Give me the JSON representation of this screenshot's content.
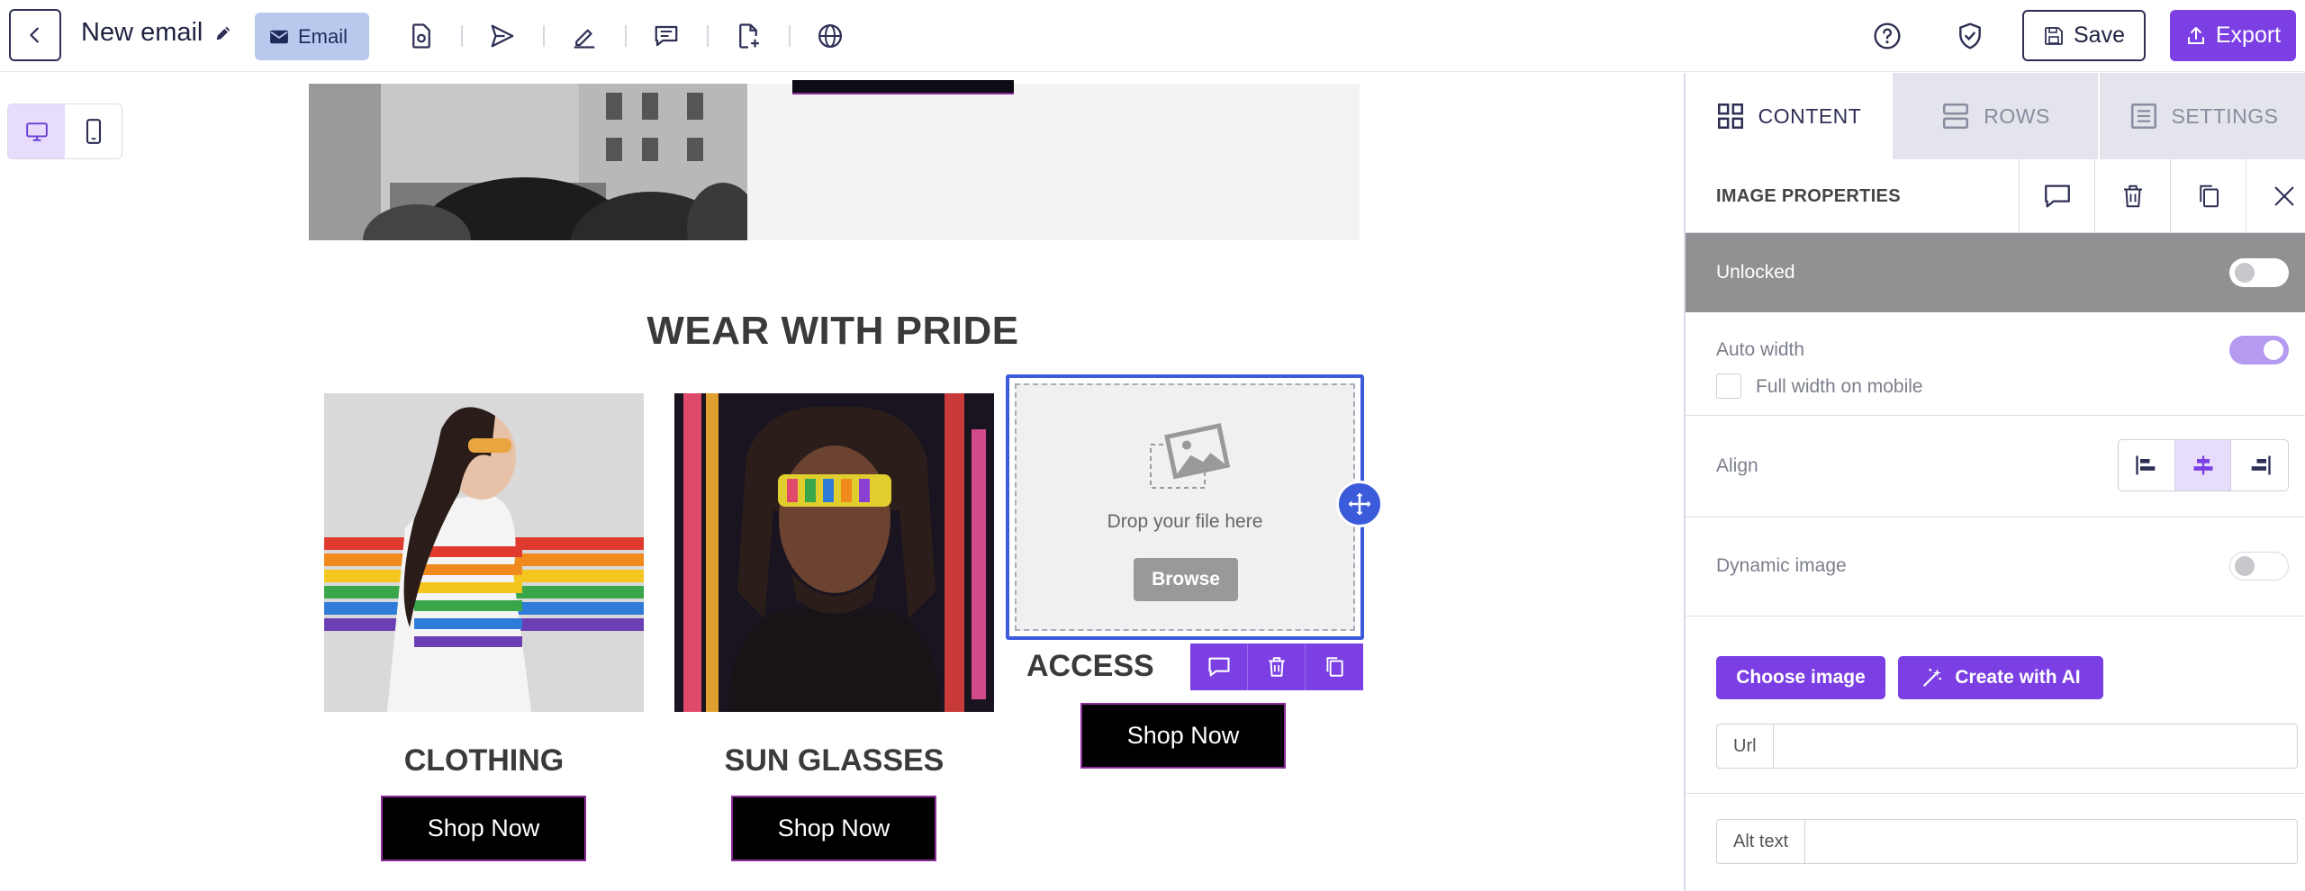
{
  "app": {
    "doc_title": "New email",
    "email_pill_label": "Email",
    "save_label": "Save",
    "export_label": "Export",
    "accent": "#7b3fe4",
    "selection": "#3b5bdb"
  },
  "toolbar_icons": [
    "file-settings-icon",
    "send-icon",
    "pen-icon",
    "comment-icon",
    "file-plus-icon",
    "globe-icon"
  ],
  "canvas": {
    "section_title": "WEAR WITH PRIDE",
    "products": [
      {
        "name": "CLOTHING",
        "button": "Shop Now"
      },
      {
        "name": "SUN GLASSES",
        "button": "Shop Now"
      },
      {
        "name": "ACCESS",
        "button": "Shop Now"
      }
    ],
    "dropzone": {
      "text": "Drop your file here",
      "browse": "Browse"
    }
  },
  "panel": {
    "tabs": [
      {
        "label": "CONTENT",
        "active": true
      },
      {
        "label": "ROWS",
        "active": false
      },
      {
        "label": "SETTINGS",
        "active": false
      }
    ],
    "title": "IMAGE PROPERTIES",
    "locked_label": "Unlocked",
    "auto_width_label": "Auto width",
    "full_width_label": "Full width on mobile",
    "align_label": "Align",
    "dynamic_image_label": "Dynamic image",
    "choose_image_label": "Choose image",
    "create_ai_label": "Create with AI",
    "url_label": "Url",
    "url_value": "",
    "alt_label": "Alt text",
    "alt_value": ""
  }
}
